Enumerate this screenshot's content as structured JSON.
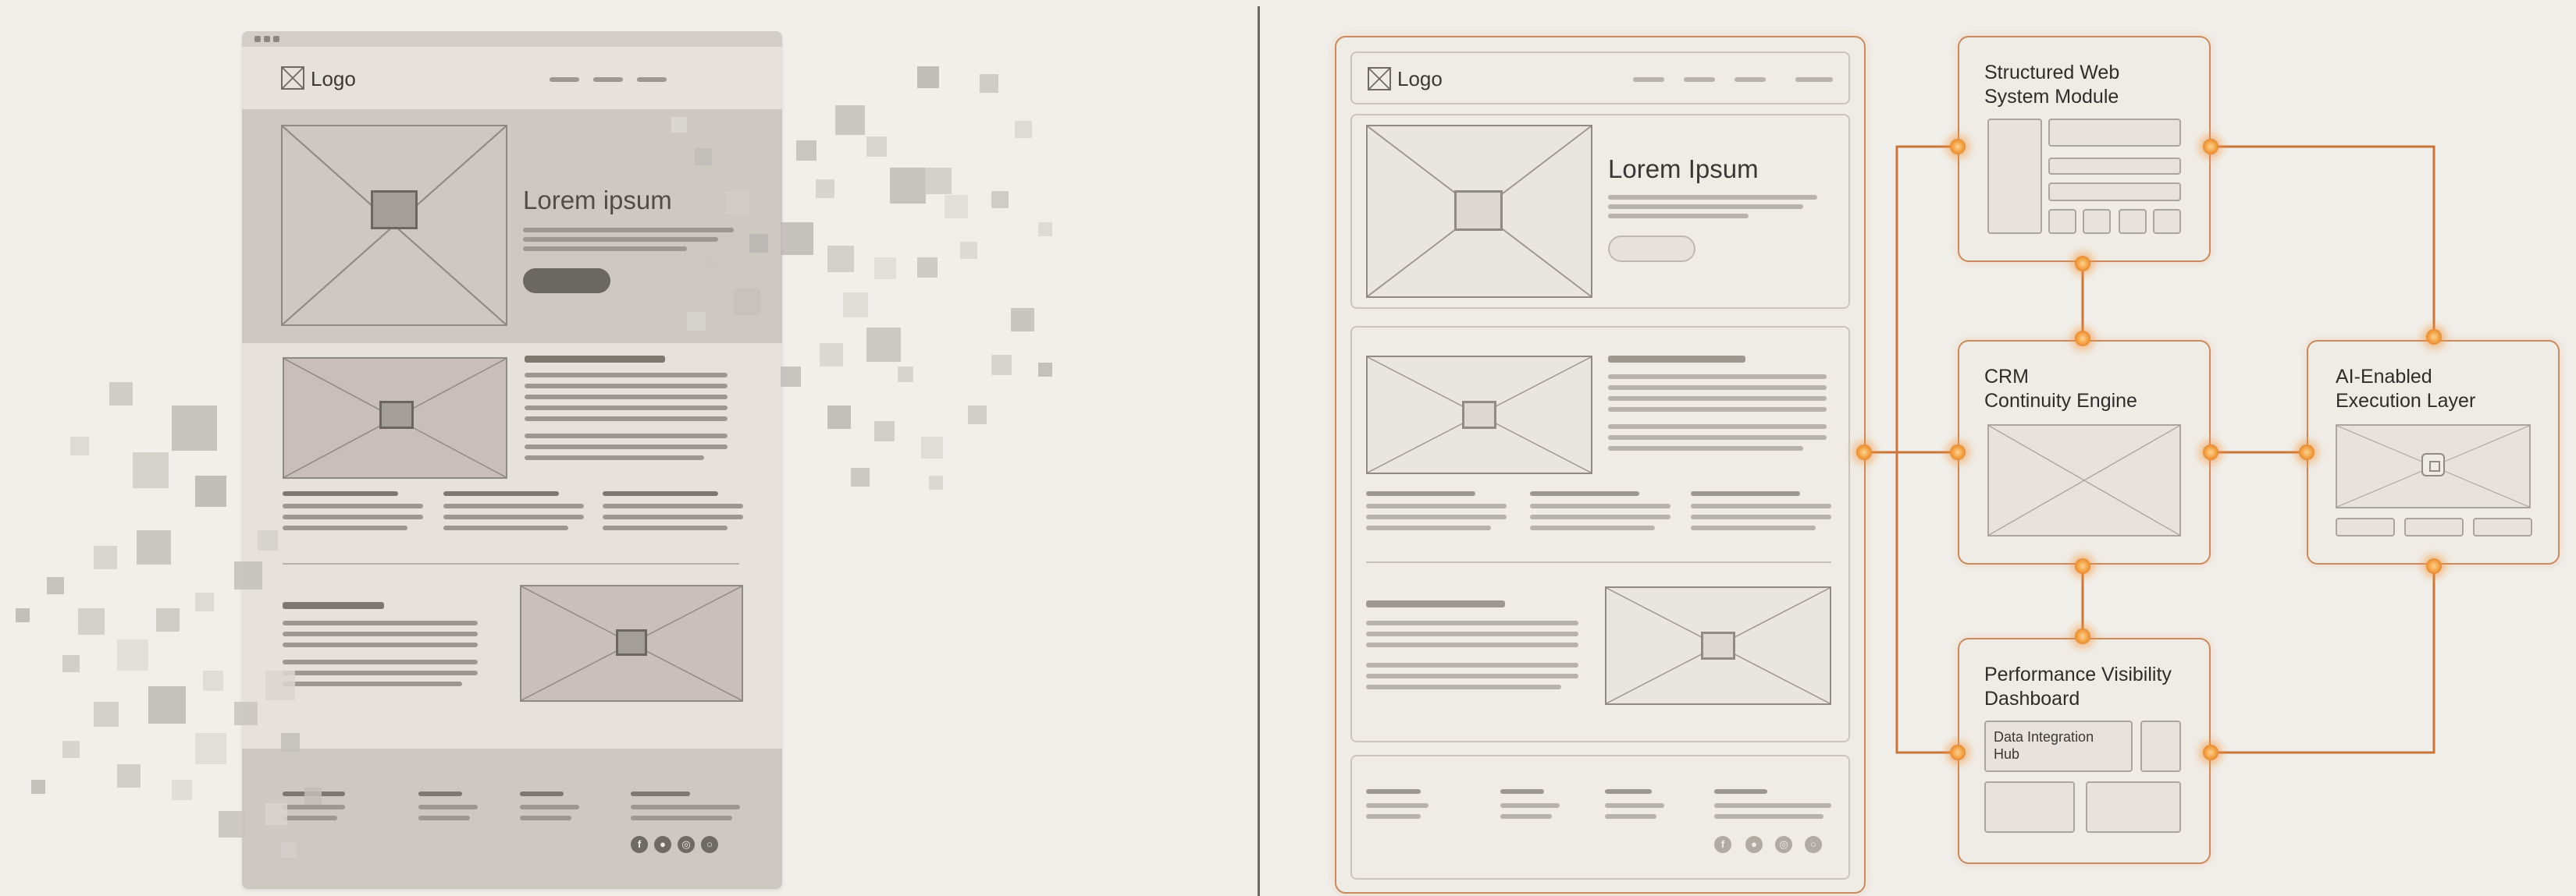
{
  "left_panel": {
    "logo": "Logo",
    "hero_title": "Lorem ipsum"
  },
  "right_panel": {
    "logo": "Logo",
    "hero_title": "Lorem Ipsum"
  },
  "modules": {
    "web_system": "Structured Web\nSystem Module",
    "crm": "CRM\nContinuity Engine",
    "ai": "AI-Enabled\nExecution Layer",
    "dashboard": "Performance Visibility\nDashboard",
    "hub": "Data Integration\nHub"
  },
  "icons": {
    "logo": "crossed-box-icon",
    "image": "image-placeholder-icon",
    "chip": "chip-icon",
    "social": [
      "facebook-icon",
      "twitter-icon",
      "instagram-icon",
      "globe-icon"
    ]
  },
  "colors": {
    "connector": "#c9763a",
    "node": "#f09a3c",
    "background": "#f1efea"
  }
}
